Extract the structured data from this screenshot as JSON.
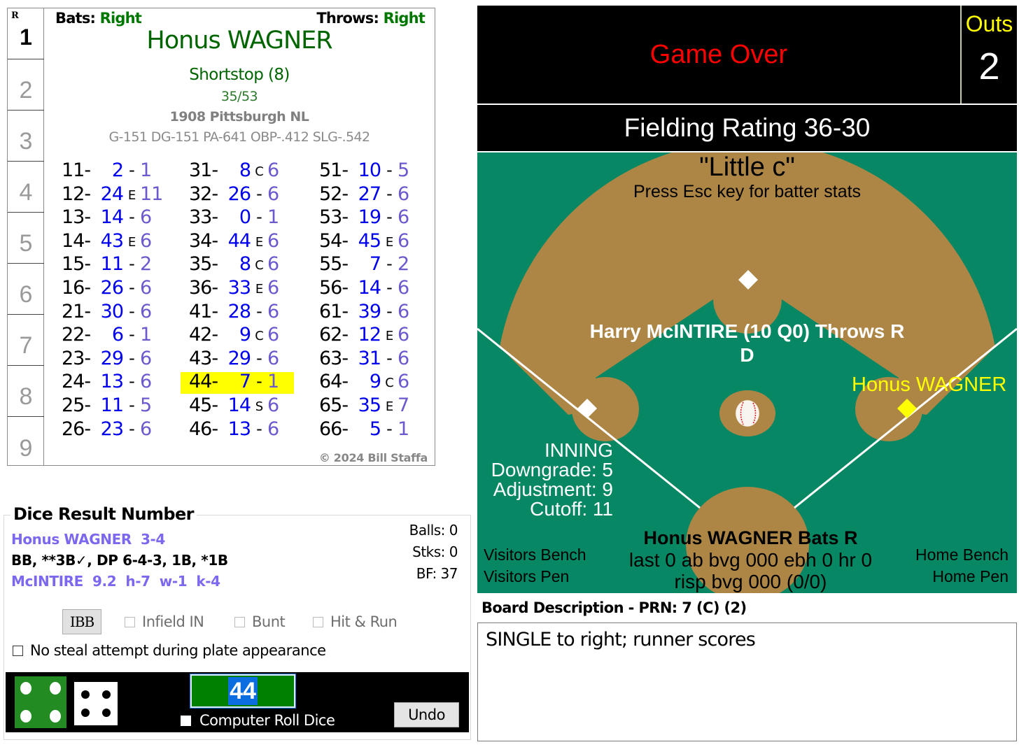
{
  "lineup": {
    "label": "R",
    "slots": [
      "1",
      "2",
      "3",
      "4",
      "5",
      "6",
      "7",
      "8",
      "9"
    ],
    "active_index": 0
  },
  "card": {
    "bats_label": "Bats:",
    "bats_value": "Right",
    "throws_label": "Throws:",
    "throws_value": "Right",
    "player_name": "Honus WAGNER",
    "position": "Shortstop (8)",
    "numbers": "35/53",
    "team": "1908 Pittsburgh NL",
    "stats": "G-151 DG-151 PA-641 OBP-.412 SLG-.542",
    "copyright": "© 2024 Bill Staffa",
    "highlighted_roll": "44",
    "columns": [
      [
        {
          "dice": "11-",
          "r1": "2",
          "mid": "-",
          "r2": "1"
        },
        {
          "dice": "12-",
          "r1": "24",
          "mid": "E",
          "r2": "11"
        },
        {
          "dice": "13-",
          "r1": "14",
          "mid": "-",
          "r2": "6"
        },
        {
          "dice": "14-",
          "r1": "43",
          "mid": "E",
          "r2": "6"
        },
        {
          "dice": "15-",
          "r1": "11",
          "mid": "-",
          "r2": "2"
        },
        {
          "dice": "16-",
          "r1": "26",
          "mid": "-",
          "r2": "6"
        },
        {
          "dice": "21-",
          "r1": "30",
          "mid": "-",
          "r2": "6"
        },
        {
          "dice": "22-",
          "r1": "6",
          "mid": "-",
          "r2": "1"
        },
        {
          "dice": "23-",
          "r1": "29",
          "mid": "-",
          "r2": "6"
        },
        {
          "dice": "24-",
          "r1": "13",
          "mid": "-",
          "r2": "6"
        },
        {
          "dice": "25-",
          "r1": "11",
          "mid": "-",
          "r2": "5"
        },
        {
          "dice": "26-",
          "r1": "23",
          "mid": "-",
          "r2": "6"
        }
      ],
      [
        {
          "dice": "31-",
          "r1": "8",
          "mid": "C",
          "r2": "6"
        },
        {
          "dice": "32-",
          "r1": "26",
          "mid": "-",
          "r2": "6"
        },
        {
          "dice": "33-",
          "r1": "0",
          "mid": "-",
          "r2": "1"
        },
        {
          "dice": "34-",
          "r1": "44",
          "mid": "E",
          "r2": "6"
        },
        {
          "dice": "35-",
          "r1": "8",
          "mid": "C",
          "r2": "6"
        },
        {
          "dice": "36-",
          "r1": "33",
          "mid": "E",
          "r2": "6"
        },
        {
          "dice": "41-",
          "r1": "28",
          "mid": "-",
          "r2": "6"
        },
        {
          "dice": "42-",
          "r1": "9",
          "mid": "C",
          "r2": "6"
        },
        {
          "dice": "43-",
          "r1": "29",
          "mid": "-",
          "r2": "6"
        },
        {
          "dice": "44-",
          "r1": "7",
          "mid": "-",
          "r2": "1"
        },
        {
          "dice": "45-",
          "r1": "14",
          "mid": "S",
          "r2": "6"
        },
        {
          "dice": "46-",
          "r1": "13",
          "mid": "-",
          "r2": "6"
        }
      ],
      [
        {
          "dice": "51-",
          "r1": "10",
          "mid": "-",
          "r2": "5"
        },
        {
          "dice": "52-",
          "r1": "27",
          "mid": "-",
          "r2": "6"
        },
        {
          "dice": "53-",
          "r1": "19",
          "mid": "-",
          "r2": "6"
        },
        {
          "dice": "54-",
          "r1": "45",
          "mid": "E",
          "r2": "6"
        },
        {
          "dice": "55-",
          "r1": "7",
          "mid": "-",
          "r2": "2"
        },
        {
          "dice": "56-",
          "r1": "14",
          "mid": "-",
          "r2": "6"
        },
        {
          "dice": "61-",
          "r1": "39",
          "mid": "-",
          "r2": "6"
        },
        {
          "dice": "62-",
          "r1": "12",
          "mid": "E",
          "r2": "6"
        },
        {
          "dice": "63-",
          "r1": "31",
          "mid": "-",
          "r2": "6"
        },
        {
          "dice": "64-",
          "r1": "9",
          "mid": "C",
          "r2": "6"
        },
        {
          "dice": "65-",
          "r1": "35",
          "mid": "E",
          "r2": "7"
        },
        {
          "dice": "66-",
          "r1": "5",
          "mid": "-",
          "r2": "1"
        }
      ]
    ]
  },
  "dice_result": {
    "title": "Dice Result Number",
    "batter_line": "Honus WAGNER  3-4",
    "results_line": "BB, **3B✓, DP 6-4-3, 1B, *1B",
    "pitcher_line": "McINTIRE  9.2  h-7  w-1  k-4",
    "balls": "Balls: 0",
    "strikes": "Stks: 0",
    "bf": "BF: 37",
    "ibb_label": "IBB",
    "infield_in_label": "Infield IN",
    "bunt_label": "Bunt",
    "hit_run_label": "Hit & Run",
    "no_steal_label": "No steal attempt during plate appearance",
    "roll_value": "44",
    "green_die": 4,
    "white_die": 4,
    "computer_roll_label": "Computer Roll Dice",
    "undo_label": "Undo"
  },
  "scoreboard": {
    "status": "Game Over",
    "outs_label": "Outs",
    "outs_value": "2",
    "fielding_rating": "Fielding Rating 36-30"
  },
  "field": {
    "title": "\"Little c\"",
    "hint": "Press Esc key for batter stats",
    "pitcher": "Harry McINTIRE (10 Q0) Throws R",
    "pitcher_grade": "D",
    "runner_on_first": "Honus WAGNER",
    "inning_lines": [
      "INNING",
      "Downgrade: 5",
      "Adjustment: 9",
      "Cutoff: 11"
    ],
    "batter": "Honus WAGNER Bats R",
    "batter_stats_1": "last 0 ab bvg 000 ebh 0 hr 0",
    "batter_stats_2": "risp bvg 000 (0/0)",
    "visitors_bench": "Visitors Bench",
    "visitors_pen": "Visitors Pen",
    "home_bench": "Home Bench",
    "home_pen": "Home Pen",
    "colors": {
      "grass": "#078763",
      "dirt": "#ad8646",
      "runner": "#ffff00"
    }
  },
  "board": {
    "label": "Board Description - PRN: 7 (C) (2)",
    "text": "SINGLE to right; runner scores"
  }
}
